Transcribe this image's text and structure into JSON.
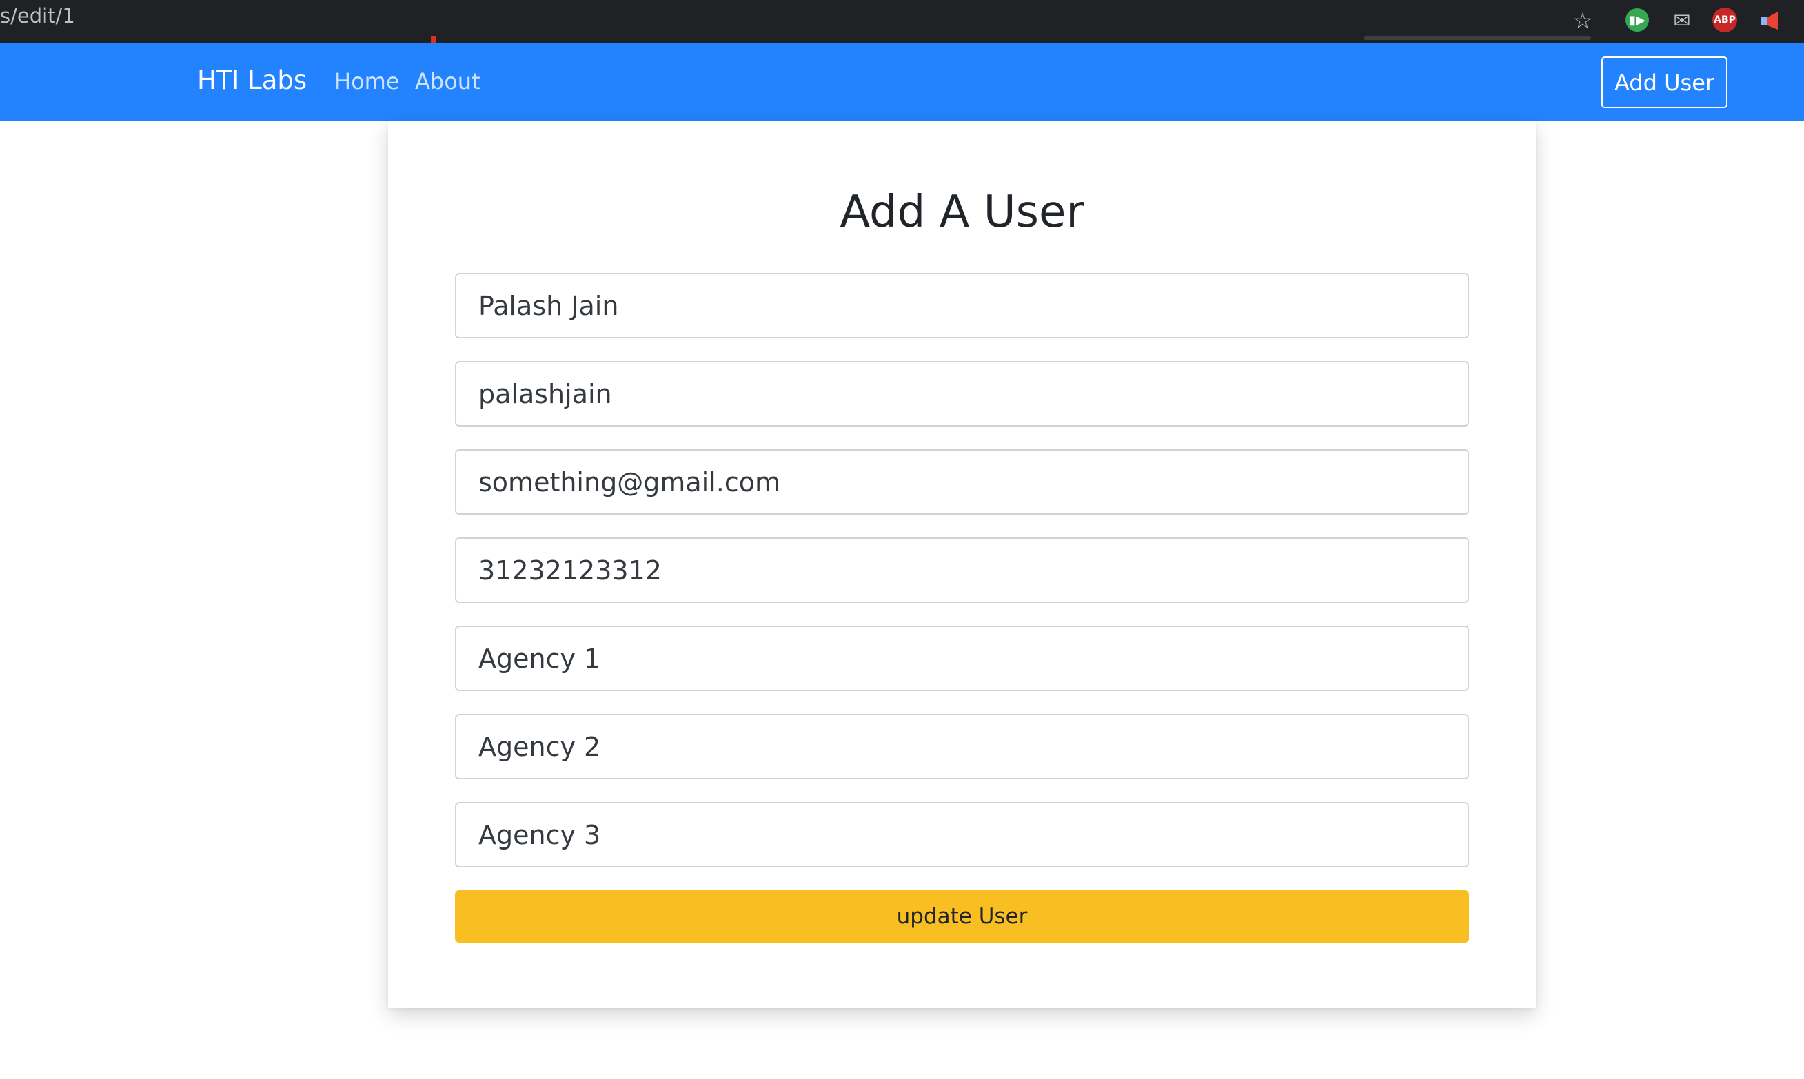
{
  "browser": {
    "url_fragment": "s/edit/1",
    "extensions": {
      "abp_label": "ABP"
    }
  },
  "navbar": {
    "brand": "HTI Labs",
    "links": [
      {
        "label": "Home"
      },
      {
        "label": "About"
      }
    ],
    "add_user_label": "Add User"
  },
  "form": {
    "title": "Add A User",
    "fields": [
      {
        "value": "Palash Jain"
      },
      {
        "value": "palashjain"
      },
      {
        "value": "something@gmail.com"
      },
      {
        "value": "31232123312"
      },
      {
        "value": "Agency 1"
      },
      {
        "value": "Agency 2"
      },
      {
        "value": "Agency 3"
      }
    ],
    "submit_label": "update User"
  },
  "colors": {
    "navbar": "#2383fe",
    "update_button": "#f8be22",
    "browser_bar": "#202124"
  }
}
